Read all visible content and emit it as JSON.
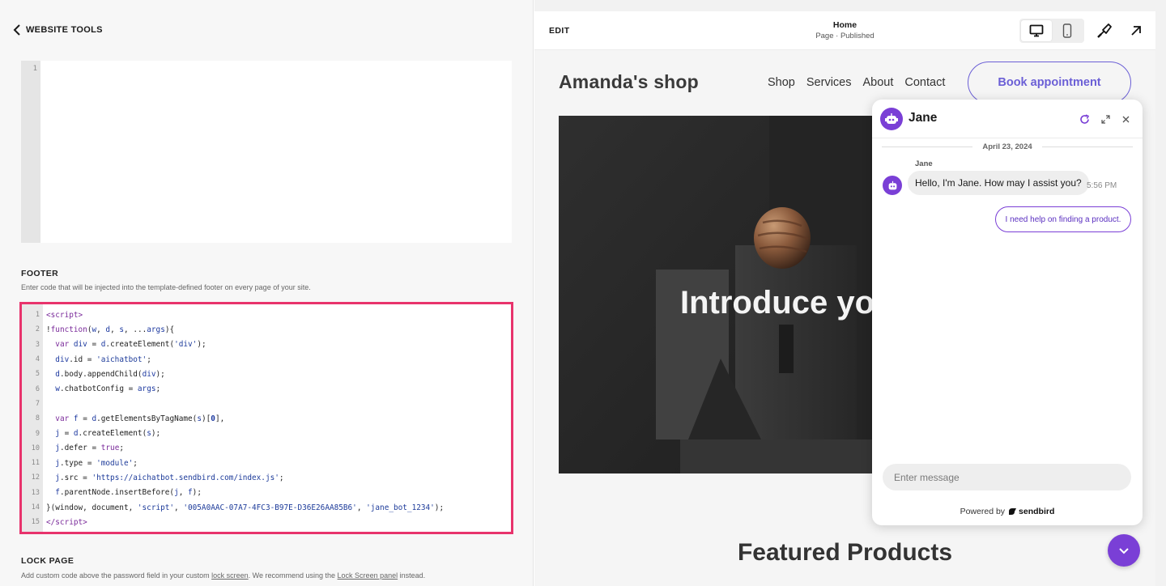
{
  "left_panel": {
    "back_label": "WEBSITE TOOLS",
    "header_editor": {
      "line_numbers": [
        "1"
      ]
    },
    "footer": {
      "title": "FOOTER",
      "description": "Enter code that will be injected into the template-defined footer on every page of your site.",
      "line_numbers": [
        "1",
        "2",
        "3",
        "4",
        "5",
        "6",
        "7",
        "8",
        "9",
        "10",
        "11",
        "12",
        "13",
        "14",
        "15"
      ]
    },
    "lock_page": {
      "title": "LOCK PAGE",
      "desc_part1": "Add custom code above the password field in your custom ",
      "desc_link1": "lock screen",
      "desc_part2": ". We recommend using the ",
      "desc_link2": "Lock Screen panel",
      "desc_part3": " instead."
    }
  },
  "topbar": {
    "edit_label": "EDIT",
    "page_title": "Home",
    "page_status": "Page · Published"
  },
  "site": {
    "logo": "Amanda's shop",
    "nav": [
      "Shop",
      "Services",
      "About",
      "Contact"
    ],
    "cta": "Book appointment",
    "hero_text": "Introduce yo",
    "featured_title": "Featured Products"
  },
  "chat": {
    "bot_name": "Jane",
    "date": "April 23, 2024",
    "sender": "Jane",
    "message": "Hello, I'm Jane. How may I assist you?",
    "time": "5:56 PM",
    "suggestion": "I need help on finding a product.",
    "input_placeholder": "Enter message",
    "powered_by": "Powered by",
    "brand": "sendbird"
  },
  "colors": {
    "accent_purple": "#7a3fd6",
    "highlight_border": "#e8336c",
    "cta_color": "#6b5fd6"
  },
  "icons": [
    "chevron-left-icon",
    "desktop-icon",
    "mobile-icon",
    "paintbrush-icon",
    "arrow-up-right-icon",
    "bot-icon",
    "refresh-icon",
    "expand-icon",
    "close-icon",
    "chevron-down-icon"
  ]
}
